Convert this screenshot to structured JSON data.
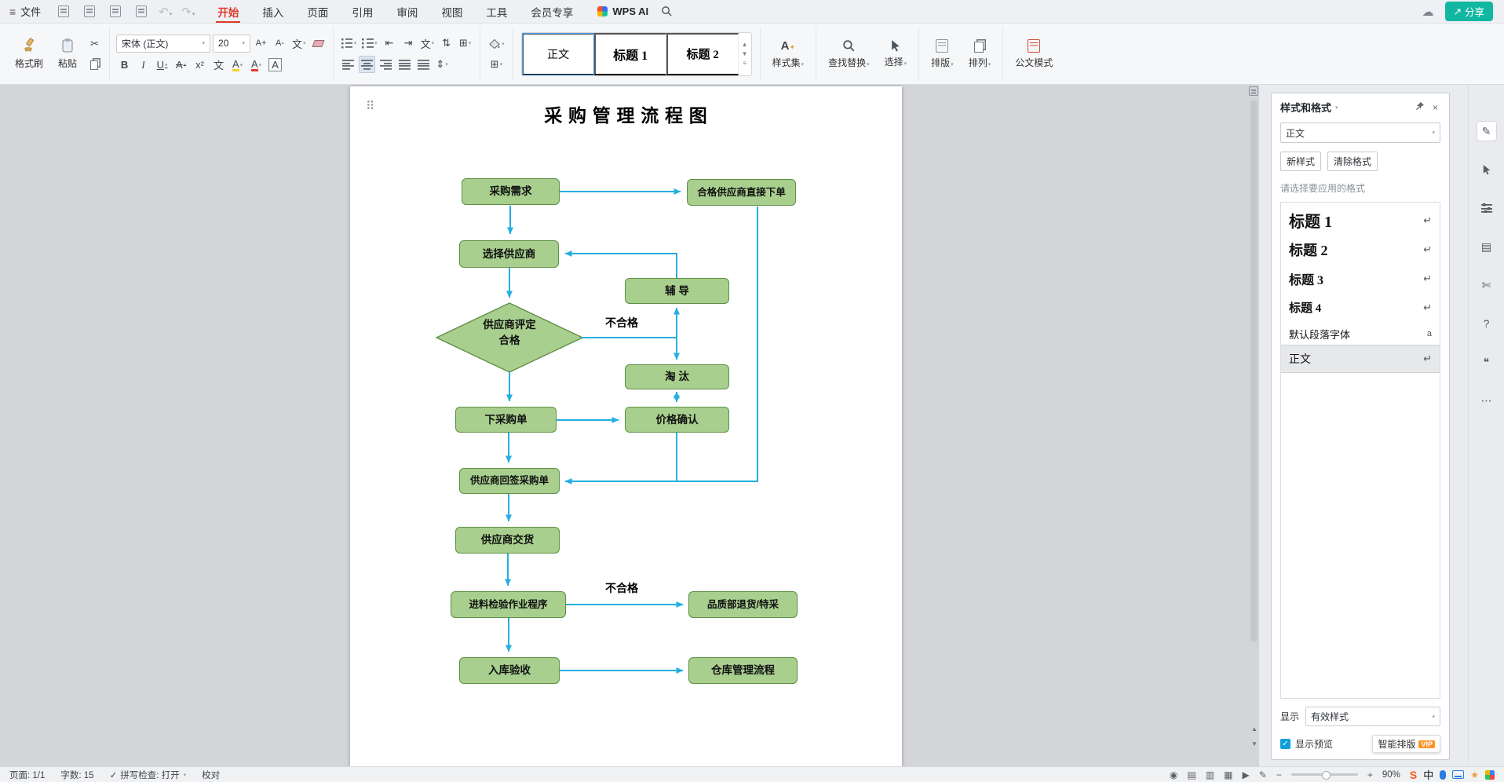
{
  "menubar": {
    "file_label": "文件",
    "tabs": [
      "开始",
      "插入",
      "页面",
      "引用",
      "审阅",
      "视图",
      "工具",
      "会员专享"
    ],
    "wps_ai_label": "WPS AI",
    "share_label": "分享"
  },
  "toolbar": {
    "format_painter_label": "格式刷",
    "paste_label": "粘贴",
    "font_name": "宋体 (正文)",
    "font_size": "20",
    "gallery": [
      "正文",
      "标题 1",
      "标题 2"
    ],
    "style_set_label": "样式集",
    "find_replace_label": "查找替换",
    "select_label": "选择",
    "layout_label": "排版",
    "arrange_label": "排列",
    "official_doc_label": "公文模式"
  },
  "icons": {
    "hamburger": "≡",
    "undo": "↶",
    "redo": "↷",
    "chevron_down": "▾",
    "cloud": "☁",
    "share_arrow": "↗",
    "scissors": "✂",
    "bold": "B",
    "italic": "I",
    "underline": "U",
    "strike": "A",
    "superscript": "x²",
    "pinyin": "文",
    "highlight": "A",
    "font_color": "A",
    "char_border": "A",
    "cjk_layout": "文",
    "sort": "⇅",
    "outdent": "⇤",
    "indent": "⇥",
    "line_spacing": "⇕",
    "table": "⊞",
    "border_box": "⊞",
    "style_set_glyph": "A",
    "sparkle": "✦",
    "doc": "▤",
    "doc_return": "↵",
    "default_font_mark": "a",
    "check": "✓",
    "dots_more": "⋯",
    "pen": "✎",
    "help": "?",
    "quote": "❝",
    "drag_handle": "⠿",
    "up": "▲",
    "down": "▼",
    "star": "★",
    "ime_s": "S",
    "eye": "◉",
    "view_outline": "▥",
    "view_web": "▦",
    "play": "▶",
    "minus": "−",
    "plus": "+",
    "close": "×",
    "clip": "✄",
    "a_plus": "A+",
    "a_minus": "A-"
  },
  "document": {
    "title": "采 购 管 理 流 程 图",
    "flowchart": {
      "nodes": {
        "n1": "采购需求",
        "n2": "合格供应商直接下单",
        "n3": "选择供应商",
        "n4": "辅 导",
        "n5a": "供应商评定",
        "n5b": "合格",
        "n6": "淘 汰",
        "n7": "下采购单",
        "n8": "价格确认",
        "n9": "供应商回签采购单",
        "n10": "供应商交货",
        "n11": "进料检验作业程序",
        "n12": "品质部退货/特采",
        "n13": "入库验收",
        "n14": "仓库管理流程"
      },
      "labels": {
        "fail1": "不合格",
        "fail2": "不合格"
      }
    }
  },
  "styles_panel": {
    "title": "样式和格式",
    "current_style": "正文",
    "new_style_label": "新样式",
    "clear_format_label": "清除格式",
    "hint": "请选择要应用的格式",
    "items": [
      {
        "label": "标题 1"
      },
      {
        "label": "标题 2"
      },
      {
        "label": "标题 3"
      },
      {
        "label": "标题 4"
      },
      {
        "label": "默认段落字体"
      },
      {
        "label": "正文"
      }
    ],
    "display_label": "显示",
    "display_value": "有效样式",
    "show_preview_label": "显示预览",
    "smart_layout_label": "智能排版",
    "vip_label": "VIP"
  },
  "statusbar": {
    "page_info": "页面: 1/1",
    "word_count": "字数: 15",
    "spellcheck": "拼写检查: 打开",
    "proofread": "校对",
    "zoom_value": "90%",
    "ime_mode": "中"
  },
  "colors": {
    "accent_red": "#dd3b2d",
    "share_teal": "#12b7a1",
    "node_fill": "#a8cf8e",
    "node_border": "#5e8f46",
    "arrow_blue": "#25afe0"
  }
}
